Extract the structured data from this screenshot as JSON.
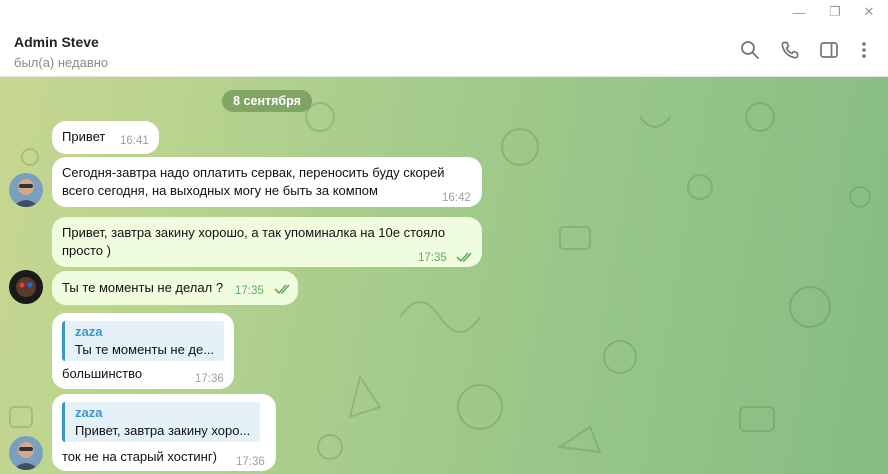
{
  "window": {
    "controls": [
      "—",
      "❐",
      "✕"
    ]
  },
  "header": {
    "name": "Admin Steve",
    "status": "был(а) недавно"
  },
  "chat": {
    "date": "8 сентября",
    "messages": [
      {
        "text": "Привет",
        "time": "16:41"
      },
      {
        "line1": "Сегодня-завтра надо оплатить сервак, переносить буду скорей",
        "line2": "всего сегодня, на выходных могу не быть за компом",
        "time": "16:42"
      },
      {
        "line1": "Привет, завтра закину хорошо, а так упоминалка на 10е стояло",
        "line2": "просто )",
        "time": "17:35"
      },
      {
        "text": "Ты те моменты не делал ?",
        "time": "17:35"
      },
      {
        "reply_name": "zaza",
        "reply_text": "Ты те моменты не де...",
        "text": "большинство",
        "time": "17:36"
      },
      {
        "reply_name": "zaza",
        "reply_text": "Привет, завтра закину хоро...",
        "text": "ток не на старый хостинг)",
        "time": "17:36"
      }
    ]
  },
  "icons": {
    "search": "search-icon",
    "call": "phone-icon",
    "sidebar": "sidebar-toggle-icon",
    "more": "more-vertical-icon"
  }
}
